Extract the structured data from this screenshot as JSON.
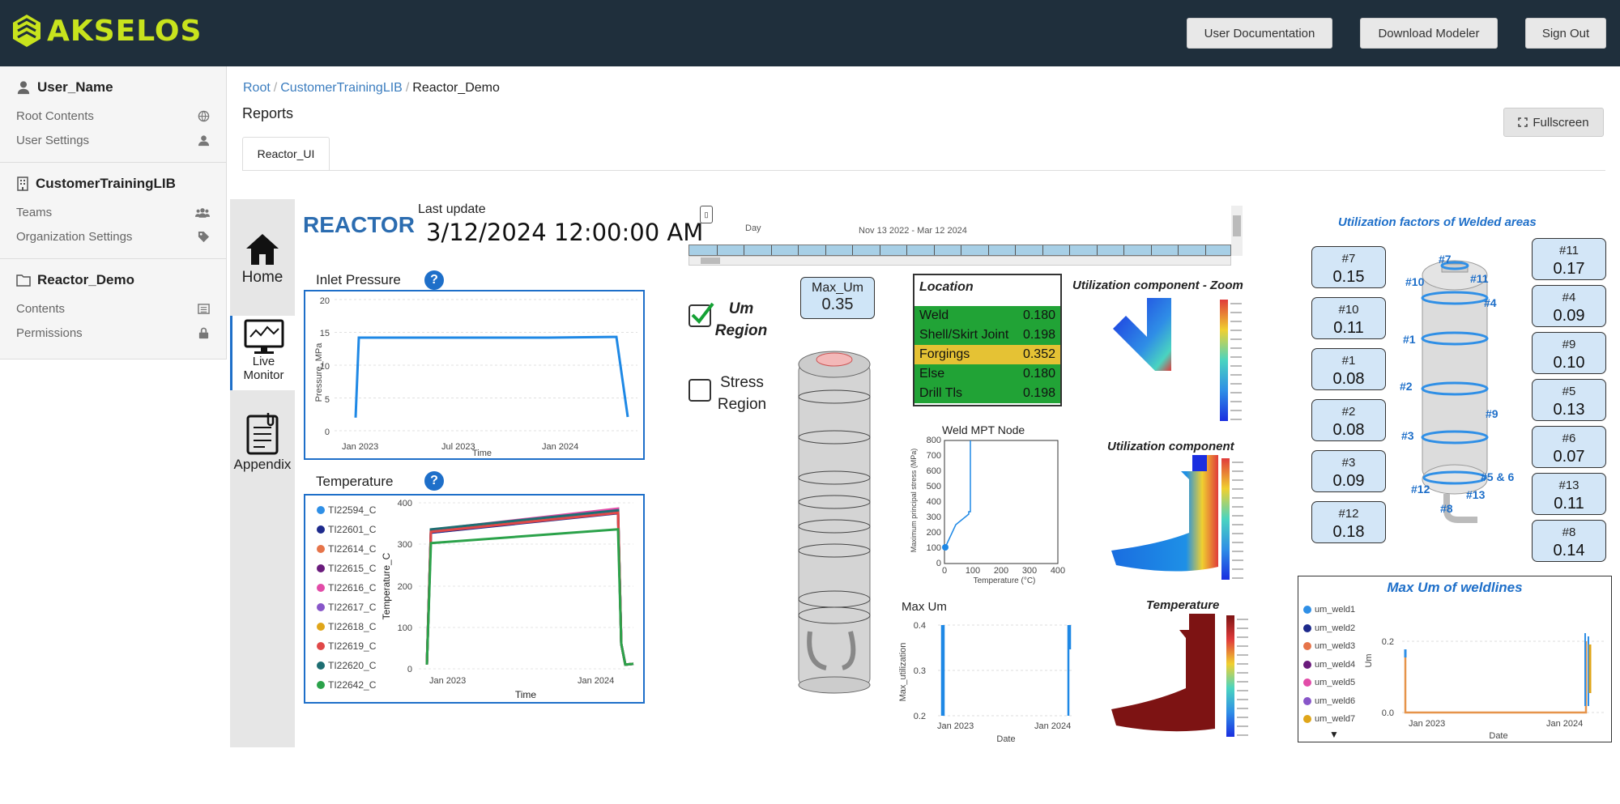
{
  "header": {
    "brand": "AKSELOS",
    "buttons": [
      "User Documentation",
      "Download Modeler",
      "Sign Out"
    ],
    "colors": {
      "bar": "#1f2f3c",
      "brand": "#c8e31d"
    }
  },
  "sidebar": {
    "sections": [
      {
        "title": "User_Name",
        "icon": "user-icon",
        "items": [
          {
            "label": "Root Contents",
            "icon": "globe-icon"
          },
          {
            "label": "User Settings",
            "icon": "user-icon"
          }
        ]
      },
      {
        "title": "CustomerTrainingLIB",
        "icon": "building-icon",
        "items": [
          {
            "label": "Teams",
            "icon": "users-icon"
          },
          {
            "label": "Organization Settings",
            "icon": "tag-icon"
          }
        ]
      },
      {
        "title": "Reactor_Demo",
        "icon": "folder-icon",
        "items": [
          {
            "label": "Contents",
            "icon": "list-icon"
          },
          {
            "label": "Permissions",
            "icon": "lock-icon"
          }
        ]
      }
    ]
  },
  "breadcrumb": {
    "items": [
      "Root",
      "CustomerTrainingLIB"
    ],
    "current": "Reactor_Demo"
  },
  "page": {
    "title": "Reports",
    "tab": "Reactor_UI",
    "fullscreen": "Fullscreen"
  },
  "nav": {
    "home": "Home",
    "live_line1": "Live",
    "live_line2": "Monitor",
    "appendix": "Appendix"
  },
  "dashboard": {
    "title": "REACTOR",
    "last_update_label": "Last update",
    "last_update": "3/12/2024 12:00:00 AM",
    "inlet_label": "Inlet Pressure",
    "temperature_label": "Temperature",
    "help": "?",
    "slicer": {
      "granularity": "Day",
      "range": "Nov 13 2022 - Mar 12 2024"
    },
    "um_region": [
      "Um",
      "Region"
    ],
    "stress_region": [
      "Stress",
      "Region"
    ],
    "max_um_label": "Max_Um",
    "max_um_value": "0.35",
    "location": {
      "title": "Location",
      "rows": [
        {
          "name": "Weld",
          "value": "0.180",
          "color": "#21a336"
        },
        {
          "name": "Shell/Skirt Joint",
          "value": "0.198",
          "color": "#21a336"
        },
        {
          "name": "Forgings",
          "value": "0.352",
          "color": "#e5c234"
        },
        {
          "name": "Else",
          "value": "0.180",
          "color": "#21a336"
        },
        {
          "name": "Drill Tls",
          "value": "0.198",
          "color": "#21a336"
        }
      ]
    },
    "util_zoom_title": "Utilization component - Zoom",
    "util_title": "Utilization component",
    "weld_title": "Weld MPT Node",
    "max_um_chart_title": "Max Um",
    "temp_title": "Temperature",
    "util_factors_title": "Utilization factors of Welded areas",
    "left_boxes": [
      {
        "id": "#7",
        "v": "0.15"
      },
      {
        "id": "#10",
        "v": "0.11"
      },
      {
        "id": "#1",
        "v": "0.08"
      },
      {
        "id": "#2",
        "v": "0.08"
      },
      {
        "id": "#3",
        "v": "0.09"
      },
      {
        "id": "#12",
        "v": "0.18"
      }
    ],
    "right_boxes": [
      {
        "id": "#11",
        "v": "0.17"
      },
      {
        "id": "#4",
        "v": "0.09"
      },
      {
        "id": "#9",
        "v": "0.10"
      },
      {
        "id": "#5",
        "v": "0.13"
      },
      {
        "id": "#6",
        "v": "0.07"
      },
      {
        "id": "#13",
        "v": "0.11"
      },
      {
        "id": "#8",
        "v": "0.14"
      }
    ],
    "vessel_labels": [
      "#7",
      "#10",
      "#11",
      "#4",
      "#1",
      "#2",
      "#9",
      "#3",
      "#12",
      "#5 & 6",
      "#13",
      "#8"
    ],
    "max_um_weldlines_title": "Max Um of weldlines"
  },
  "chart_data": [
    {
      "type": "line",
      "title": "Inlet Pressure",
      "xlabel": "Time",
      "ylabel": "Pressure_MPa",
      "xticks": [
        "Jan 2023",
        "Jul 2023",
        "Jan 2024"
      ],
      "yticks": [
        "0",
        "5",
        "10",
        "15",
        "20"
      ],
      "ylim": [
        0,
        20
      ],
      "series": [
        {
          "values": [
            2,
            14.2,
            14.2,
            14.2,
            14.3,
            14.3,
            2.1
          ]
        }
      ]
    },
    {
      "type": "line",
      "title": "Temperature",
      "xlabel": "Time",
      "ylabel": "Temperature_C",
      "xticks": [
        "Jan 2023",
        "Jan 2024"
      ],
      "yticks": [
        "0",
        "100",
        "200",
        "300",
        "400"
      ],
      "ylim": [
        0,
        400
      ],
      "series": [
        {
          "name": "TI22594_C",
          "color": "#2f8fe6"
        },
        {
          "name": "TI22601_C",
          "color": "#1d2a8c"
        },
        {
          "name": "TI22614_C",
          "color": "#e6744a"
        },
        {
          "name": "TI22615_C",
          "color": "#6a1b7c"
        },
        {
          "name": "TI22616_C",
          "color": "#e24ca8"
        },
        {
          "name": "TI22617_C",
          "color": "#8856c9"
        },
        {
          "name": "TI22618_C",
          "color": "#e0a61a"
        },
        {
          "name": "TI22619_C",
          "color": "#e04848"
        },
        {
          "name": "TI22620_C",
          "color": "#1e6e72"
        },
        {
          "name": "TI22642_C",
          "color": "#2ba24a"
        }
      ]
    },
    {
      "type": "line",
      "title": "Weld MPT Node",
      "xlabel": "Temperature (°C)",
      "ylabel": "Maximum principal stress (MPa)",
      "xticks": [
        "0",
        "100",
        "200",
        "300",
        "400"
      ],
      "yticks": [
        "0",
        "100",
        "200",
        "300",
        "400",
        "500",
        "600",
        "700",
        "800"
      ],
      "xlim": [
        0,
        400
      ],
      "ylim": [
        0,
        800
      ]
    },
    {
      "type": "line",
      "title": "Max Um",
      "xlabel": "Date",
      "ylabel": "Max_utilization",
      "xticks": [
        "Jan 2023",
        "Jan 2024"
      ],
      "yticks": [
        "0.2",
        "0.3",
        "0.4"
      ],
      "ylim": [
        0.2,
        0.4
      ]
    },
    {
      "type": "line",
      "title": "Max Um of weldlines",
      "xlabel": "Date",
      "ylabel": "Um",
      "xticks": [
        "Jan 2023",
        "Jan 2024"
      ],
      "yticks": [
        "0.0",
        "0.2"
      ],
      "series": [
        {
          "name": "um_weld1",
          "color": "#2f8fe6"
        },
        {
          "name": "um_weld2",
          "color": "#1d2a8c"
        },
        {
          "name": "um_weld3",
          "color": "#e6744a"
        },
        {
          "name": "um_weld4",
          "color": "#6a1b7c"
        },
        {
          "name": "um_weld5",
          "color": "#e24ca8"
        },
        {
          "name": "um_weld6",
          "color": "#8856c9"
        },
        {
          "name": "um_weld7",
          "color": "#e0a61a"
        }
      ]
    }
  ]
}
